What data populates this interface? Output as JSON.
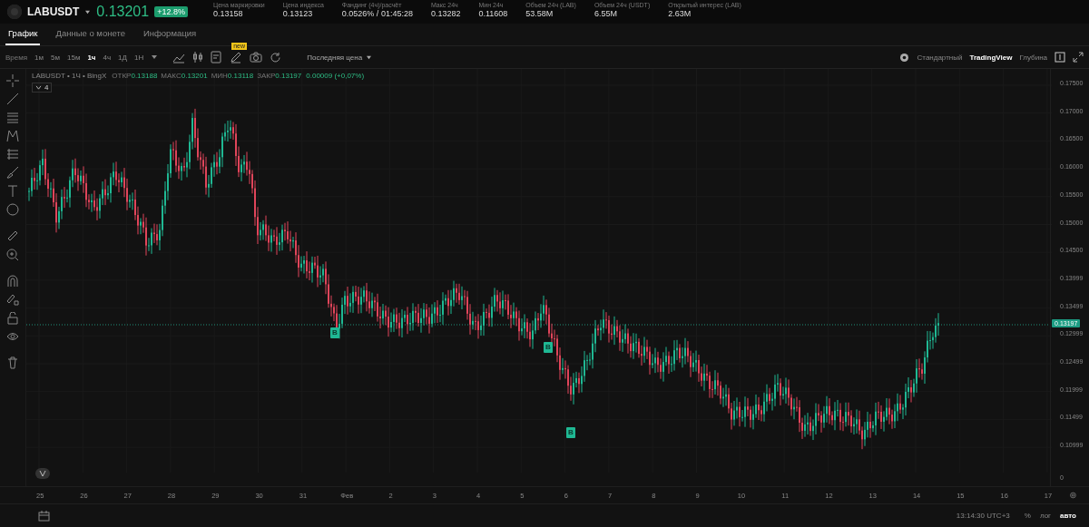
{
  "ticker": {
    "symbol": "LABUSDT",
    "price": "0.13201",
    "change": "+12.8%"
  },
  "stats": [
    {
      "label": "Цена маркировки",
      "value": "0.13158"
    },
    {
      "label": "Цена индекса",
      "value": "0.13123"
    },
    {
      "label": "Фандинг (4ч)/расчёт",
      "value": "0.0526% / 01:45:28"
    },
    {
      "label": "Макс 24ч",
      "value": "0.13282"
    },
    {
      "label": "Мин 24ч",
      "value": "0.11608"
    },
    {
      "label": "Объем 24ч (LAB)",
      "value": "53.58M"
    },
    {
      "label": "Объем 24ч (USDT)",
      "value": "6.55M"
    },
    {
      "label": "Открытый интерес (LAB)",
      "value": "2.63M"
    }
  ],
  "tabs": [
    {
      "label": "График",
      "selected": true
    },
    {
      "label": "Данные о монете",
      "selected": false
    },
    {
      "label": "Информация",
      "selected": false
    }
  ],
  "intervals": {
    "label": "Время",
    "items": [
      {
        "label": "1м",
        "selected": false
      },
      {
        "label": "5м",
        "selected": false
      },
      {
        "label": "15м",
        "selected": false
      },
      {
        "label": "1ч",
        "selected": true
      },
      {
        "label": "4ч",
        "selected": false
      },
      {
        "label": "1Д",
        "selected": false
      },
      {
        "label": "1Н",
        "selected": false
      }
    ]
  },
  "new_badge": "new",
  "price_type": "Последняя цена",
  "view_modes": [
    {
      "label": "Стандартный",
      "selected": false
    },
    {
      "label": "TradingView",
      "selected": true
    },
    {
      "label": "Глубина",
      "selected": false
    }
  ],
  "legend": {
    "title": "LABUSDT • 1Ч • BingX",
    "values": [
      {
        "label": "ОТКР",
        "value": "0.13188"
      },
      {
        "label": "МАКС",
        "value": "0.13201"
      },
      {
        "label": "МИН",
        "value": "0.13118"
      },
      {
        "label": "ЗАКР",
        "value": "0.13197"
      }
    ],
    "change": "0.00009 (+0,07%)",
    "indicators": "4"
  },
  "markers": [
    {
      "label": "B"
    },
    {
      "label": "B"
    },
    {
      "label": "B"
    }
  ],
  "price_axis": {
    "labels": [
      "0.17500",
      "0.17000",
      "0.16500",
      "0.16000",
      "0.15500",
      "0.15000",
      "0.14500",
      "0.13999",
      "0.13499",
      "0.12999",
      "0.12499",
      "0.11999",
      "0.11499",
      "0.10999"
    ],
    "zero": "0",
    "current_price": "0.13197"
  },
  "time_axis": {
    "labels": [
      "25",
      "26",
      "27",
      "28",
      "29",
      "30",
      "31",
      "Фев",
      "2",
      "3",
      "4",
      "5",
      "6",
      "7",
      "8",
      "9",
      "10",
      "11",
      "12",
      "13",
      "14",
      "15",
      "16",
      "17"
    ]
  },
  "status_bar": {
    "time": "13:14:30 UTC+3",
    "scales": [
      {
        "label": "%",
        "selected": false
      },
      {
        "label": "лог",
        "selected": false
      },
      {
        "label": "авто",
        "selected": true
      }
    ]
  }
}
